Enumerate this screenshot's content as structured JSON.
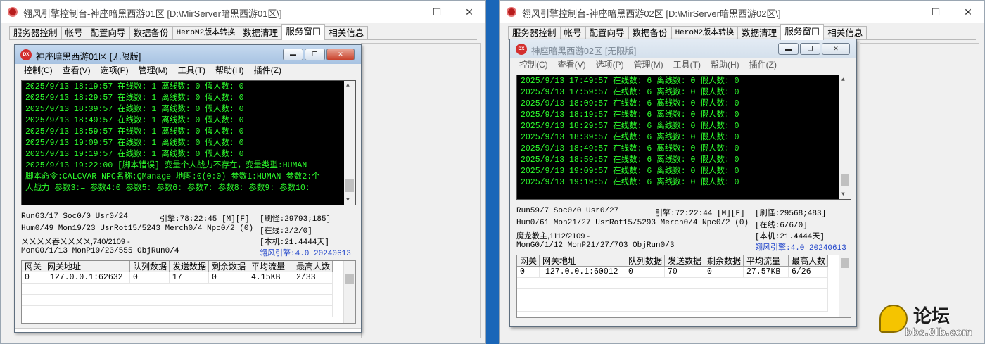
{
  "win1": {
    "title": "翎风引擎控制台-神座暗黑西游01区 [D:\\MirServer暗黑西游01区\\]",
    "tabs": [
      "服务器控制",
      "帐号",
      "配置向导",
      "数据备份",
      "HeroM2版本转换",
      "数据清理",
      "服务窗口",
      "相关信息"
    ],
    "active_tab": 6,
    "inner": {
      "title": "神座暗黑西游01区 [无限版]",
      "menus": [
        "控制(C)",
        "查看(V)",
        "选项(P)",
        "管理(M)",
        "工具(T)",
        "帮助(H)",
        "插件(Z)"
      ],
      "log": [
        "2025/9/13 18:19:57 在线数: 1 离线数: 0 假人数: 0",
        "2025/9/13 18:29:57 在线数: 1 离线数: 0 假人数: 0",
        "2025/9/13 18:39:57 在线数: 1 离线数: 0 假人数: 0",
        "2025/9/13 18:49:57 在线数: 1 离线数: 0 假人数: 0",
        "2025/9/13 18:59:57 在线数: 1 离线数: 0 假人数: 0",
        "2025/9/13 19:09:57 在线数: 1 离线数: 0 假人数: 0",
        "2025/9/13 19:19:57 在线数: 1 离线数: 0 假人数: 0",
        "2025/9/13 19:22:00 [脚本错误] 变量个人战力不存在，变量类型:HUMAN",
        "脚本命令:CALCVAR NPC名称:QManage 地图:0(0:0) 参数1:HUMAN 参数2:个",
        "人战力 参数3:= 参数4:0 参数5: 参数6: 参数7: 参数8: 参数9: 参数10:"
      ],
      "status": {
        "l1": "Run63/17 Soc0/0 Usr0/24",
        "l2": "Hum0/49 Mon19/23 UsrRot15/5243 Merch0/4 Npc0/2 (0)",
        "l3": "ㄨㄨㄨㄨ吞ㄨㄨㄨㄨ,740/2109 -",
        "l4": "MonG0/1/13 MonP19/23/555 ObjRun0/4",
        "engine": "引擎:78:22:45 [M][F]",
        "refresh": "[刷怪:29793;185]",
        "online": "[在线:2/2/0]",
        "local": "[本机:21.4444天]",
        "version": "翎风引擎:4.0 20240613"
      },
      "grid": {
        "headers": [
          "网关",
          "网关地址",
          "队列数据",
          "发送数据",
          "剩余数据",
          "平均流量",
          "最高人数"
        ],
        "rows": [
          [
            "0",
            "127.0.0.1:62632",
            "0",
            "17",
            "0",
            "4.15KB",
            "2/33"
          ]
        ]
      }
    }
  },
  "win2": {
    "title": "翎风引擎控制台-神座暗黑西游02区 [D:\\MirServer暗黑西游02区\\]",
    "tabs": [
      "服务器控制",
      "帐号",
      "配置向导",
      "数据备份",
      "HeroM2版本转换",
      "数据清理",
      "服务窗口",
      "相关信息"
    ],
    "active_tab": 6,
    "inner": {
      "title": "神座暗黑西游02区 [无限版]",
      "menus": [
        "控制(C)",
        "查看(V)",
        "选项(P)",
        "管理(M)",
        "工具(T)",
        "帮助(H)",
        "插件(Z)"
      ],
      "log": [
        "2025/9/13 17:49:57 在线数: 6 离线数: 0 假人数: 0",
        "2025/9/13 17:59:57 在线数: 6 离线数: 0 假人数: 0",
        "2025/9/13 18:09:57 在线数: 6 离线数: 0 假人数: 0",
        "2025/9/13 18:19:57 在线数: 6 离线数: 0 假人数: 0",
        "2025/9/13 18:29:57 在线数: 6 离线数: 0 假人数: 0",
        "2025/9/13 18:39:57 在线数: 6 离线数: 0 假人数: 0",
        "2025/9/13 18:49:57 在线数: 6 离线数: 0 假人数: 0",
        "2025/9/13 18:59:57 在线数: 6 离线数: 0 假人数: 0",
        "2025/9/13 19:09:57 在线数: 6 离线数: 0 假人数: 0",
        "2025/9/13 19:19:57 在线数: 6 离线数: 0 假人数: 0"
      ],
      "status": {
        "l1": "Run59/7 Soc0/0 Usr0/27",
        "l2": "Hum0/61 Mon21/27 UsrRot15/5293 Merch0/4 Npc0/2 (0)",
        "l3": "魔龙教主,1112/2109 -",
        "l4": "MonG0/1/12 MonP21/27/703 ObjRun0/3",
        "engine": "引擎:72:22:44 [M][F]",
        "refresh": "[刷怪:29568;483]",
        "online": "[在线:6/6/0]",
        "local": "[本机:21.4444天]",
        "version": "翎风引擎:4.0 20240613"
      },
      "grid": {
        "headers": [
          "网关",
          "网关地址",
          "队列数据",
          "发送数据",
          "剩余数据",
          "平均流量",
          "最高人数"
        ],
        "rows": [
          [
            "0",
            "127.0.0.1:60012",
            "0",
            "70",
            "0",
            "27.57KB",
            "6/26"
          ]
        ]
      }
    }
  },
  "watermark": {
    "text": "论坛",
    "url": "bbs.0lb.com"
  },
  "colors": {
    "desktop": "#1a66b8",
    "console_text": "#2dff2d",
    "status_blue": "#1a3fc9"
  }
}
